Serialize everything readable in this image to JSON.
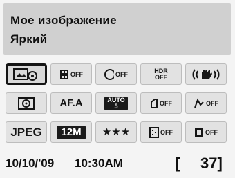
{
  "header": {
    "line1": "Мое изображение",
    "line2": "Яркий"
  },
  "rows": [
    [
      {
        "name": "custom-image-icon",
        "text": ""
      },
      {
        "name": "digital-filter-off",
        "text": "OFF"
      },
      {
        "name": "dynamic-range-off",
        "text": "OFF"
      },
      {
        "name": "hdr-off",
        "text": "HDR OFF"
      },
      {
        "name": "shake-reduction-icon",
        "text": ""
      }
    ],
    [
      {
        "name": "metering-icon",
        "text": ""
      },
      {
        "name": "af-mode",
        "text": "AF.A"
      },
      {
        "name": "af-point-auto5",
        "text": "AUTO 5"
      },
      {
        "name": "lens-correction-off",
        "text": "OFF"
      },
      {
        "name": "wb-off",
        "text": "OFF"
      }
    ],
    [
      {
        "name": "file-format",
        "text": "JPEG"
      },
      {
        "name": "recorded-pixels",
        "text": "12M"
      },
      {
        "name": "quality",
        "text": "★★★"
      },
      {
        "name": "noise-reduction-off",
        "text": "OFF"
      },
      {
        "name": "shading-off",
        "text": "OFF"
      }
    ]
  ],
  "footer": {
    "date": "10/10/'09",
    "time": "10:30AM",
    "bracket": "[",
    "count": "37]"
  }
}
